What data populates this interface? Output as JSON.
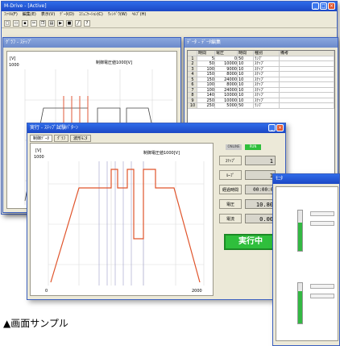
{
  "main_window": {
    "title": "M-Drive - [Active]",
    "menu": [
      "ﾌｧｲﾙ(F)",
      "編集(E)",
      "表示(V)",
      "ﾃﾞｰﾀ(D)",
      "ｺﾐｭﾆｹｰｼｮﾝ(C)",
      "ｳｨﾝﾄﾞｳ(W)",
      "ﾍﾙﾌﾟ(H)"
    ]
  },
  "graph_window_back": {
    "title": "ｸﾞﾗﾌ - ｽﾃｯﾌﾟ",
    "ylabel": "[V]",
    "ymax": "1000",
    "note": "制御電圧値1000[V]"
  },
  "data_window": {
    "title": "ﾃﾞｰﾀ - ﾃﾞｰﾀ編集",
    "columns": [
      "",
      "時間",
      "電圧",
      "時間",
      "種別",
      "備考"
    ],
    "rows": [
      [
        "1",
        "5",
        "0",
        "50",
        "ﾗﾝﾌﾟ",
        ""
      ],
      [
        "2",
        "50",
        "10000",
        "10",
        "ｽﾃｯﾌﾟ",
        ""
      ],
      [
        "3",
        "100",
        "9000",
        "10",
        "ｽﾃｯﾌﾟ",
        ""
      ],
      [
        "4",
        "150",
        "8000",
        "10",
        "ｽﾃｯﾌﾟ",
        ""
      ],
      [
        "5",
        "150",
        "24000",
        "10",
        "ｽﾃｯﾌﾟ",
        ""
      ],
      [
        "6",
        "100",
        "8000",
        "10",
        "ｽﾃｯﾌﾟ",
        ""
      ],
      [
        "7",
        "100",
        "24000",
        "10",
        "ｽﾃｯﾌﾟ",
        ""
      ],
      [
        "8",
        "140",
        "10000",
        "10",
        "ｽﾃｯﾌﾟ",
        ""
      ],
      [
        "9",
        "250",
        "10000",
        "10",
        "ｽﾃｯﾌﾟ",
        ""
      ],
      [
        "10",
        "250",
        "5000",
        "50",
        "ﾗﾝﾌﾟ",
        ""
      ]
    ]
  },
  "run_window": {
    "title": "実行 - ｽﾃｯﾌﾟ試験ﾊﾟﾀｰﾝ",
    "tabs": [
      "制御ﾃﾞｰﾀ",
      "ｸﾞﾗﾌ",
      "波形ﾓﾆﾀ"
    ],
    "ylabel": "[V]",
    "ymax": "1000",
    "note": "制御電圧値1000[V]",
    "status": [
      "ONLINE",
      "RUN"
    ],
    "rows": [
      {
        "label": "ｽﾃｯﾌﾟ",
        "value": "1"
      },
      {
        "label": "ﾙｰﾌﾟ",
        "value": "1"
      },
      {
        "label": "経過時間",
        "value": "00:00:04"
      },
      {
        "label": "電圧",
        "value": "10.80"
      },
      {
        "label": "電流",
        "value": "0.00"
      }
    ],
    "run_label": "実行中",
    "xstart": "0",
    "xend": "2000"
  },
  "monitor_window": {
    "title": "ﾓﾆﾀ"
  },
  "caption": "▲画面サンプル"
}
